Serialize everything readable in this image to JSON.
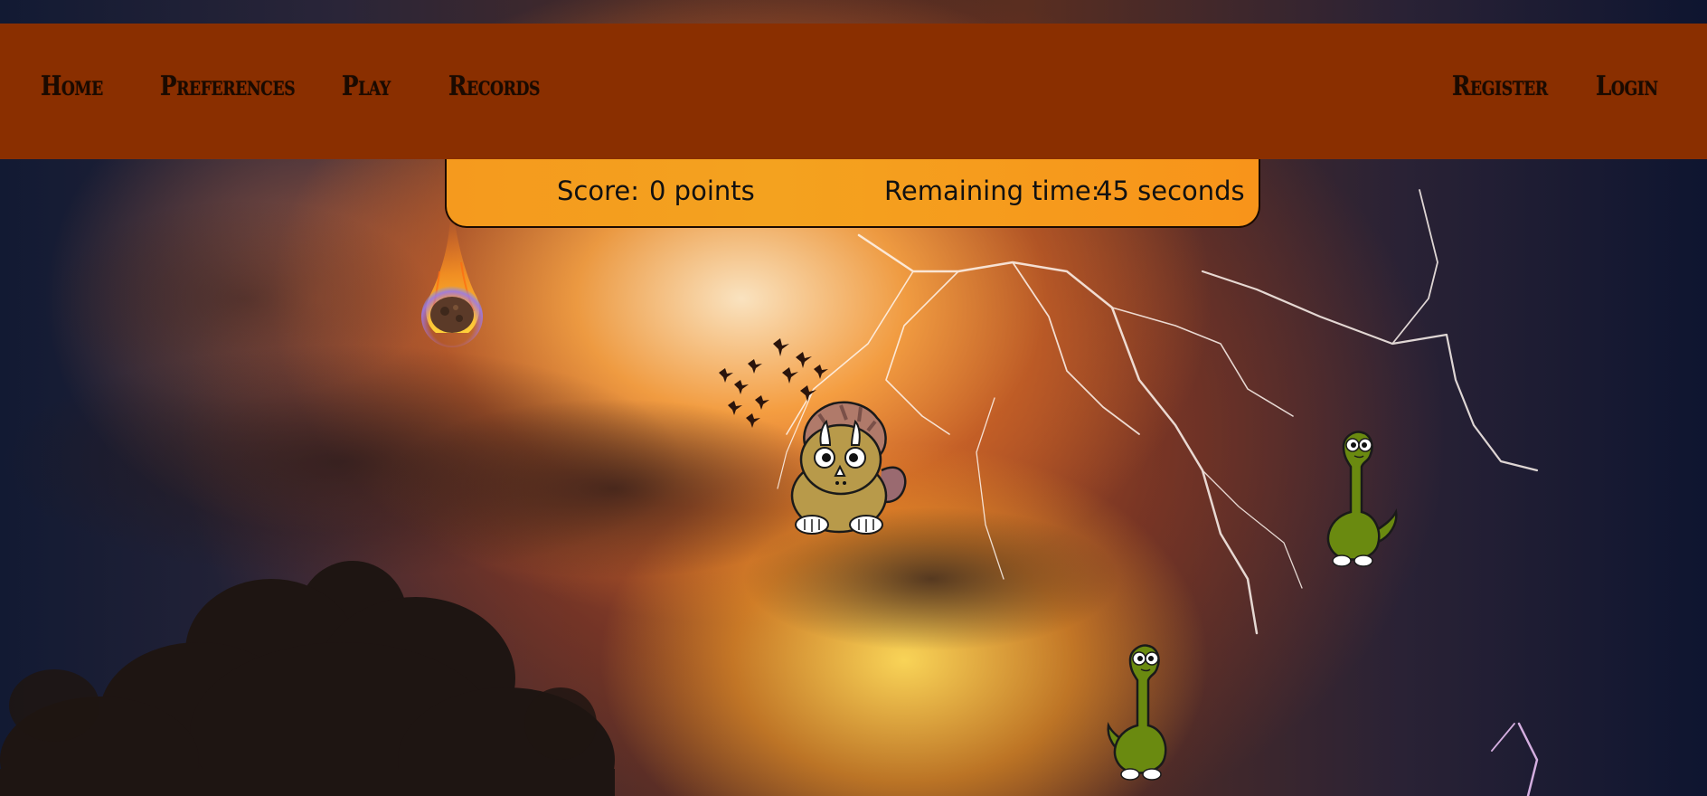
{
  "nav": {
    "left": [
      {
        "label": "Home"
      },
      {
        "label": "Preferences"
      },
      {
        "label": "Play"
      },
      {
        "label": "Records"
      }
    ],
    "right": [
      {
        "label": "Register"
      },
      {
        "label": "Login"
      }
    ]
  },
  "hud": {
    "score_label": "Score:",
    "score_value": "0 points",
    "time_label": "Remaining time:",
    "time_value": "45 seconds"
  },
  "sprites": {
    "meteor": "meteor-icon",
    "birds": "bird-flock-icon",
    "triceratops": "triceratops-icon",
    "brachiosaurus": "brachiosaurus-icon"
  },
  "colors": {
    "navbar": "#8a2f00",
    "panel": "#f59a1e",
    "nav_text": "#1a0a00"
  }
}
